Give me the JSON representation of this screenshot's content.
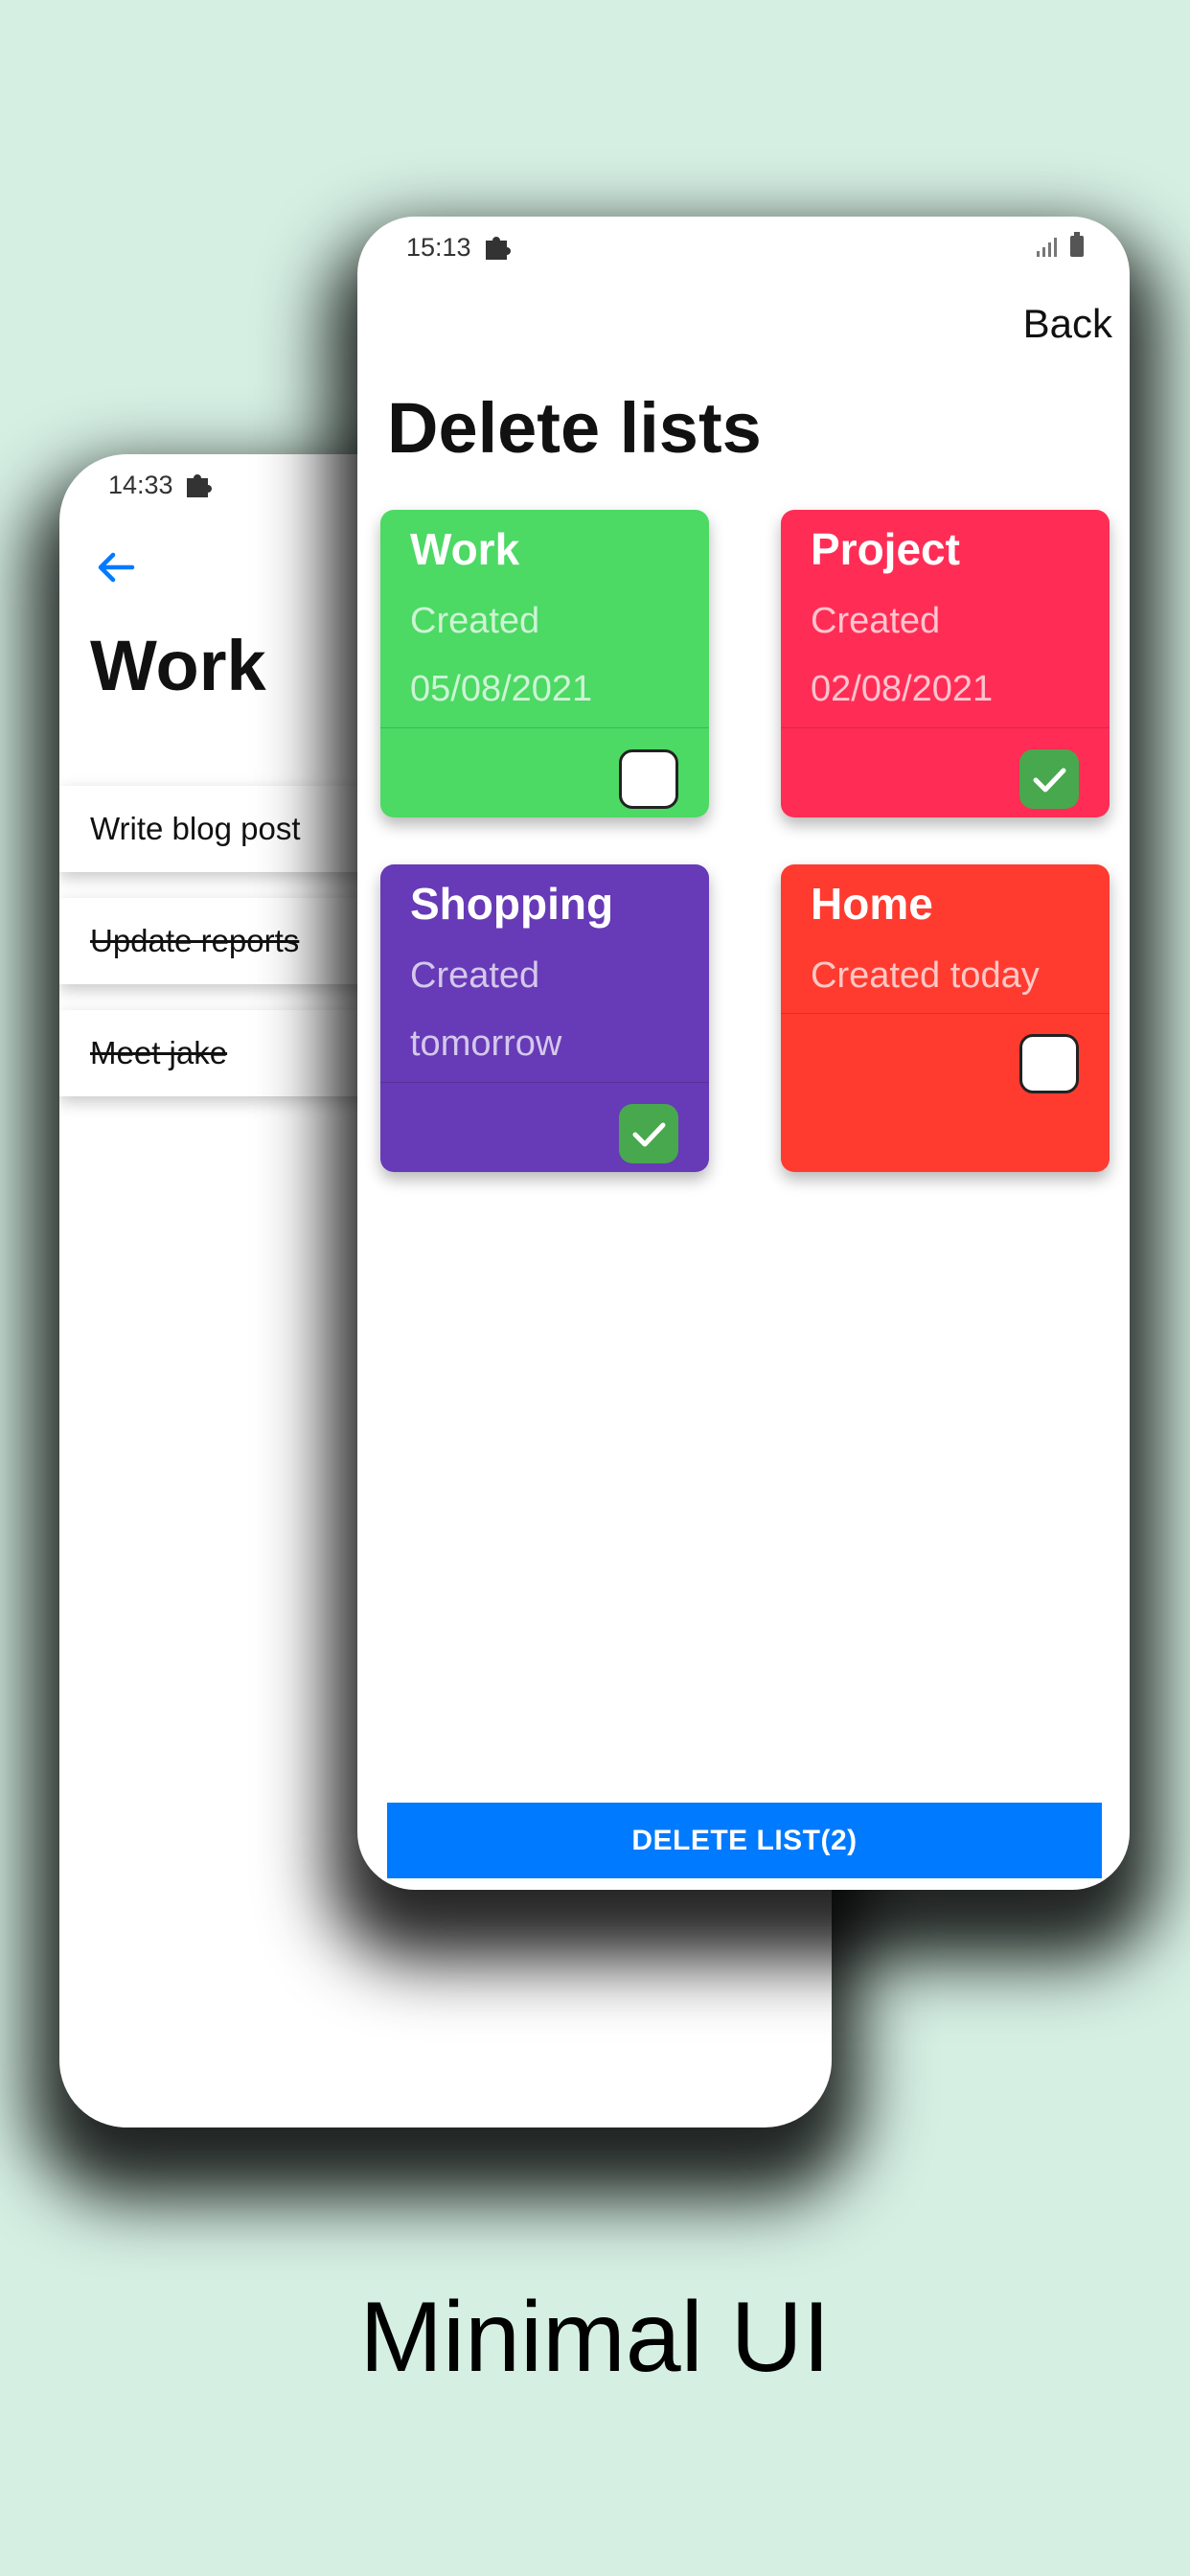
{
  "back_screen": {
    "status_time": "14:33",
    "title": "Work",
    "tasks": [
      {
        "text": "Write blog post",
        "done": false
      },
      {
        "text": "Update reports",
        "done": true
      },
      {
        "text": "Meet jake",
        "done": true
      }
    ]
  },
  "front_screen": {
    "status_time": "15:13",
    "back_label": "Back",
    "title": "Delete lists",
    "lists": [
      {
        "name": "Work",
        "line1": "Created",
        "line2": "05/08/2021",
        "checked": false,
        "color": "#4cd964"
      },
      {
        "name": "Project",
        "line1": "Created",
        "line2": "02/08/2021",
        "checked": true,
        "color": "#ff2d55"
      },
      {
        "name": "Shopping",
        "line1": "Created",
        "line2": "tomorrow",
        "checked": true,
        "color": "#673ab7"
      },
      {
        "name": "Home",
        "line1": "Created today",
        "line2": "",
        "checked": false,
        "color": "#ff3b30"
      }
    ],
    "delete_button_label": "DELETE LIST(2)"
  },
  "tagline": "Minimal UI",
  "colors": {
    "background": "#d5efe3",
    "accent": "#007aff",
    "check_green": "#47a84d"
  },
  "icons": [
    "puzzle-icon",
    "back-arrow-icon",
    "signal-icon",
    "battery-icon",
    "checkmark-icon"
  ]
}
